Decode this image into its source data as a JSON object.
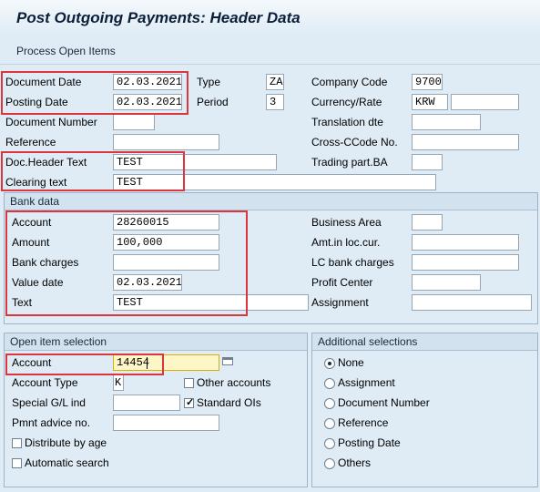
{
  "window": {
    "title": "Post Outgoing Payments: Header Data"
  },
  "toolbar": {
    "process_open_items": "Process Open Items"
  },
  "header": {
    "document_date": {
      "label": "Document Date",
      "value": "02.03.2021"
    },
    "posting_date": {
      "label": "Posting Date",
      "value": "02.03.2021"
    },
    "document_number": {
      "label": "Document Number",
      "value": ""
    },
    "reference": {
      "label": "Reference",
      "value": ""
    },
    "doc_header_text": {
      "label": "Doc.Header Text",
      "value": "TEST"
    },
    "clearing_text": {
      "label": "Clearing text",
      "value": "TEST"
    },
    "type": {
      "label": "Type",
      "value": "ZA"
    },
    "period": {
      "label": "Period",
      "value": "3"
    },
    "company_code": {
      "label": "Company Code",
      "value": "9700"
    },
    "currency_rate": {
      "label": "Currency/Rate",
      "value": "KRW",
      "rate": ""
    },
    "translation_dte": {
      "label": "Translation dte",
      "value": ""
    },
    "cross_ccode_no": {
      "label": "Cross-CCode No.",
      "value": ""
    },
    "trading_part_ba": {
      "label": "Trading part.BA",
      "value": ""
    }
  },
  "bank_data": {
    "title": "Bank data",
    "account": {
      "label": "Account",
      "value": "28260015"
    },
    "amount": {
      "label": "Amount",
      "value": "100,000"
    },
    "bank_charges": {
      "label": "Bank charges",
      "value": ""
    },
    "value_date": {
      "label": "Value date",
      "value": "02.03.2021"
    },
    "text": {
      "label": "Text",
      "value": "TEST"
    },
    "business_area": {
      "label": "Business Area",
      "value": ""
    },
    "amt_loc_cur": {
      "label": "Amt.in loc.cur.",
      "value": ""
    },
    "lc_bank_charges": {
      "label": "LC bank charges",
      "value": ""
    },
    "profit_center": {
      "label": "Profit Center",
      "value": ""
    },
    "assignment": {
      "label": "Assignment",
      "value": ""
    }
  },
  "open_item_selection": {
    "title": "Open item selection",
    "account": {
      "label": "Account",
      "value": "14454"
    },
    "account_type": {
      "label": "Account Type",
      "value": "K"
    },
    "other_accounts": {
      "label": "Other accounts",
      "checked": false
    },
    "special_gl_ind": {
      "label": "Special G/L ind",
      "value": ""
    },
    "standard_ois": {
      "label": "Standard OIs",
      "checked": true
    },
    "pmnt_advice_no": {
      "label": "Pmnt advice no.",
      "value": ""
    },
    "distribute_by_age": {
      "label": "Distribute by age",
      "checked": false
    },
    "automatic_search": {
      "label": "Automatic search",
      "checked": false
    }
  },
  "additional_selections": {
    "title": "Additional selections",
    "options": [
      "None",
      "Assignment",
      "Document Number",
      "Reference",
      "Posting Date",
      "Others"
    ],
    "selected": "None"
  },
  "icons": {
    "match_code": "match-code-icon"
  },
  "colors": {
    "background": "#dfebf5",
    "highlight_border": "#d9363e",
    "focused_field": "#fff6c8"
  }
}
